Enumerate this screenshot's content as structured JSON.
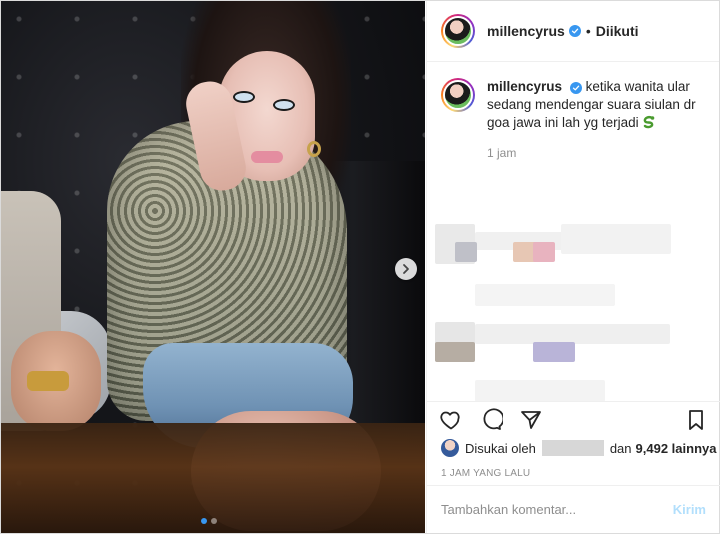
{
  "post": {
    "username": "millencyrus",
    "separator": "•",
    "follow_status": "Diikuti"
  },
  "caption": {
    "username": "millencyrus",
    "text": "ketika wanita ular sedang mendengar suara siulan dr goa jawa ini lah yg terjadi",
    "emoji_icon": "snake-icon",
    "time_ago": "1 jam"
  },
  "likes": {
    "prefix": "Disukai oleh",
    "middle": "dan",
    "count": "9,492 lainnya"
  },
  "post_time": "1 JAM YANG LALU",
  "comment": {
    "placeholder": "Tambahkan komentar...",
    "post_label": "Kirim"
  },
  "carousel": {
    "total": 2,
    "active_index": 0
  },
  "colors": {
    "accent": "#3897f0",
    "post_button_disabled": "#b2dffc",
    "muted_text": "#8e8e8e"
  },
  "icons": {
    "heart": "heart-icon",
    "comment": "comment-icon",
    "share": "share-icon",
    "save": "bookmark-icon",
    "next": "chevron-right-icon",
    "verified": "verified-badge-icon"
  }
}
